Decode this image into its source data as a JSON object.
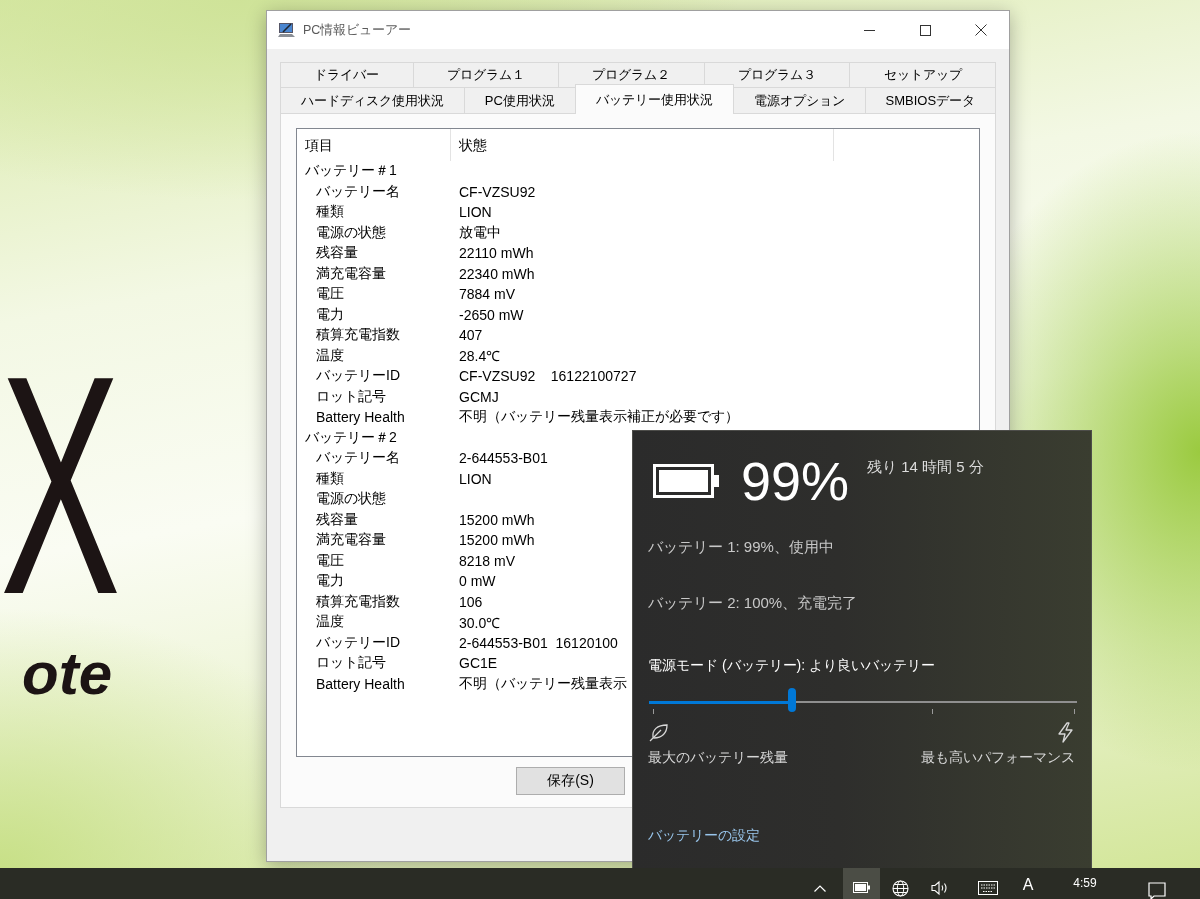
{
  "wallpaper": {
    "mark": "X",
    "wordmark": "ote"
  },
  "window": {
    "title": "PC情報ビューアー"
  },
  "tab_rows": [
    [
      {
        "label": "ドライバー",
        "selected": false
      },
      {
        "label": "プログラム１",
        "selected": false
      },
      {
        "label": "プログラム２",
        "selected": false
      },
      {
        "label": "プログラム３",
        "selected": false
      },
      {
        "label": "セットアップ",
        "selected": false
      }
    ],
    [
      {
        "label": "ハードディスク使用状況",
        "selected": false
      },
      {
        "label": "PC使用状況",
        "selected": false
      },
      {
        "label": "バッテリー使用状況",
        "selected": true
      },
      {
        "label": "電源オプション",
        "selected": false
      },
      {
        "label": "SMBIOSデータ",
        "selected": false
      }
    ]
  ],
  "list": {
    "columns": [
      "項目",
      "状態"
    ],
    "groups": [
      {
        "label": "バッテリー＃1",
        "rows": [
          {
            "item": "バッテリー名",
            "value": "CF-VZSU92"
          },
          {
            "item": "種類",
            "value": "LION"
          },
          {
            "item": "電源の状態",
            "value": "放電中"
          },
          {
            "item": "残容量",
            "value": "22110 mWh"
          },
          {
            "item": "満充電容量",
            "value": "22340 mWh"
          },
          {
            "item": "電圧",
            "value": "7884 mV"
          },
          {
            "item": "電力",
            "value": "-2650 mW"
          },
          {
            "item": "積算充電指数",
            "value": "407"
          },
          {
            "item": "温度",
            "value": "28.4℃"
          },
          {
            "item": "バッテリーID",
            "value": "CF-VZSU92    16122100727"
          },
          {
            "item": "ロット記号",
            "value": "GCMJ"
          },
          {
            "item": "Battery Health",
            "value": "不明（バッテリー残量表示補正が必要です）"
          }
        ]
      },
      {
        "label": "バッテリー＃2",
        "rows": [
          {
            "item": "バッテリー名",
            "value": "2-644553-B01"
          },
          {
            "item": "種類",
            "value": "LION"
          },
          {
            "item": "電源の状態"
          },
          {
            "item": "残容量",
            "value": "15200 mWh"
          },
          {
            "item": "満充電容量",
            "value": "15200 mWh"
          },
          {
            "item": "電圧",
            "value": "8218 mV"
          },
          {
            "item": "電力",
            "value": "0 mW"
          },
          {
            "item": "積算充電指数",
            "value": "106"
          },
          {
            "item": "温度",
            "value": "30.0℃"
          },
          {
            "item": "バッテリーID",
            "value": "2-644553-B01  16120100"
          },
          {
            "item": "ロット記号",
            "value": "GC1E"
          },
          {
            "item": "Battery Health",
            "value": "不明（バッテリー残量表示"
          }
        ]
      }
    ]
  },
  "buttons": [
    {
      "label": "保存(S)"
    }
  ],
  "battery_flyout": {
    "percent": "99%",
    "remaining": "残り 14 時間 5 分",
    "batteries": [
      "バッテリー 1: 99%、使用中",
      "バッテリー 2: 100%、充電完了"
    ],
    "power_mode": {
      "label": "電源モード (バッテリー): より良いバッテリー",
      "level": 0.334,
      "min_label": "最大のバッテリー残量",
      "max_label": "最も高いパフォーマンス"
    },
    "settings_link": "バッテリーの設定"
  },
  "taskbar": {
    "battery_button": {
      "selected": true
    },
    "input_mode": "A",
    "clock": "4:59"
  }
}
